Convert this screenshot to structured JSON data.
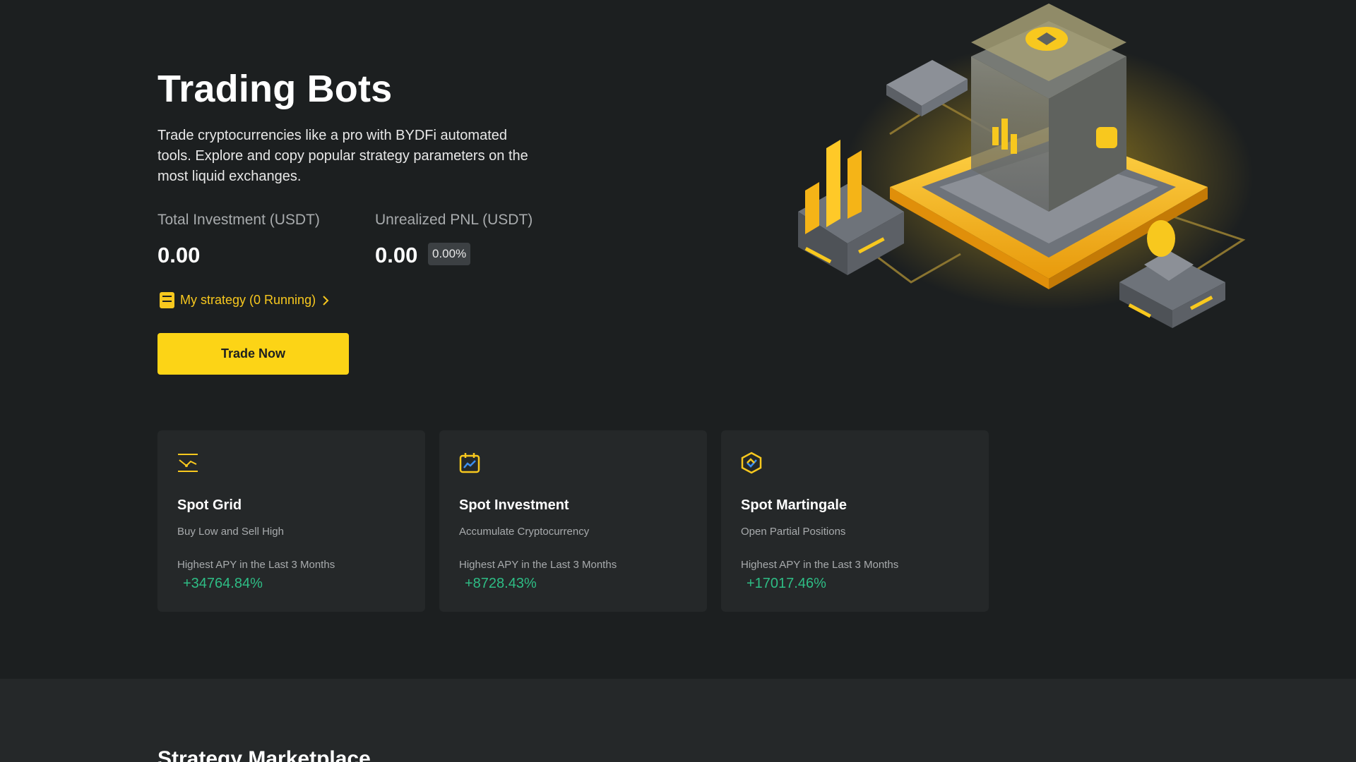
{
  "hero": {
    "title": "Trading Bots",
    "description": "Trade cryptocurrencies like a pro with BYDFi automated tools. Explore and copy popular strategy parameters on the most liquid exchanges.",
    "total_investment_label": "Total Investment (USDT)",
    "total_investment_value": "0.00",
    "unrealized_pnl_label": "Unrealized PNL (USDT)",
    "unrealized_pnl_value": "0.00",
    "unrealized_pnl_percent": "0.00%",
    "strategy_link": "My strategy (0 Running)",
    "trade_button": "Trade Now"
  },
  "cards": [
    {
      "icon": "grid-chart-icon",
      "name": "Spot Grid",
      "subtitle": "Buy Low and Sell High",
      "apy_label": "Highest APY in the Last 3 Months",
      "apy_value": "+34764.84%"
    },
    {
      "icon": "calendar-chart-icon",
      "name": "Spot Investment",
      "subtitle": "Accumulate Cryptocurrency",
      "apy_label": "Highest APY in the Last 3 Months",
      "apy_value": "+8728.43%"
    },
    {
      "icon": "hexagon-check-icon",
      "name": "Spot Martingale",
      "subtitle": "Open Partial Positions",
      "apy_label": "Highest APY in the Last 3 Months",
      "apy_value": "+17017.46%"
    }
  ],
  "marketplace": {
    "title": "Strategy Marketplace"
  },
  "colors": {
    "accent": "#fcd416",
    "positive": "#2ebd85",
    "background": "#1c1f20",
    "card": "#252829"
  }
}
